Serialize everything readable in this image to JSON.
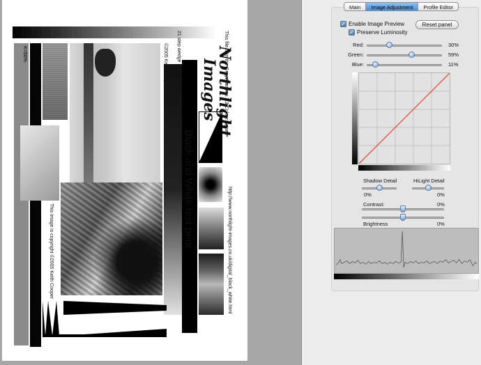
{
  "preview": {
    "wedge_label": "21 step wedge",
    "copyright_small": "©2005 Keith Cooper",
    "k_label": "K<50%",
    "gamma_text": "This file is in the Grey Gamma 2.2 Colour Space",
    "logo_line1": "Northlight",
    "logo_line2": "Images",
    "title": "Black and White test print",
    "url": "http://www.northlight-images.co.uk/digital_black_white.html",
    "copyright_long": "This image is copyright ©2005 Keith Cooper"
  },
  "tabs": [
    {
      "label": "Main",
      "active": false
    },
    {
      "label": "Image Adjustment",
      "active": true
    },
    {
      "label": "Profile Editor",
      "active": false
    }
  ],
  "options": {
    "enable_preview": {
      "label": "Enable Image Preview",
      "checked": true
    },
    "preserve_luminosity": {
      "label": "Preserve Luminosity",
      "checked": true
    },
    "reset_label": "Reset panel"
  },
  "channels": [
    {
      "name": "red",
      "label": "Red:",
      "value": 30,
      "display": "30%"
    },
    {
      "name": "green",
      "label": "Green:",
      "value": 59,
      "display": "59%"
    },
    {
      "name": "blue",
      "label": "Blue:",
      "value": 11,
      "display": "11%"
    }
  ],
  "detail": {
    "shadow_label": "Shadow Detail",
    "shadow_display": "0%",
    "shadow_value": 0,
    "hilight_label": "HiLight Detail",
    "hilight_display": "0%",
    "hilight_value": 0
  },
  "contrast": {
    "label": "Contrast:",
    "display": "0%",
    "value": 0
  },
  "brightness": {
    "label": "Brightness",
    "display": "0%",
    "value": 0
  },
  "colors": {
    "curve": "#e0402a",
    "accent": "#3f8ee0"
  }
}
